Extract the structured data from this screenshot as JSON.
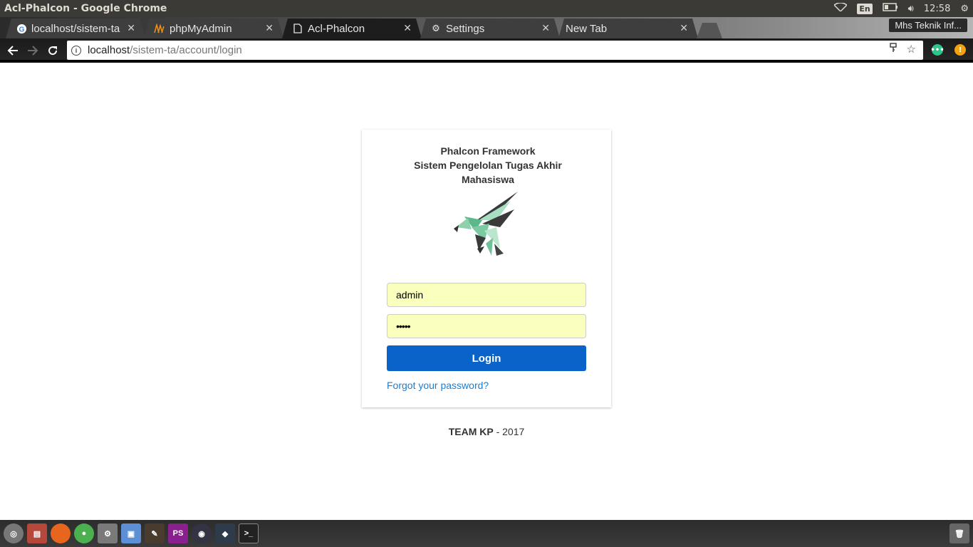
{
  "window": {
    "title": "Acl-Phalcon - Google Chrome"
  },
  "system": {
    "lang": "En",
    "time": "12:58"
  },
  "tabs": [
    {
      "label": "localhost/sistem-ta",
      "icon": "google-icon"
    },
    {
      "label": "phpMyAdmin",
      "icon": "phpmyadmin-icon"
    },
    {
      "label": "Acl-Phalcon",
      "icon": "page-icon"
    },
    {
      "label": "Settings",
      "icon": "gear-icon"
    },
    {
      "label": "New Tab",
      "icon": ""
    }
  ],
  "profile": {
    "label": "Mhs Teknik Inf..."
  },
  "address": {
    "host": "localhost",
    "path": "/sistem-ta/account/login"
  },
  "login": {
    "title_line1": "Phalcon Framework",
    "title_line2": "Sistem Pengelolan Tugas Akhir",
    "title_line3": "Mahasiswa",
    "username_value": "admin",
    "password_value": "•••••",
    "login_label": "Login",
    "forgot_label": "Forgot your password?"
  },
  "footer": {
    "team": "TEAM KP",
    "year": " - 2017"
  },
  "colors": {
    "login_button": "#0a63c9",
    "autofill": "#faffbd",
    "link": "#1a7fd4"
  }
}
